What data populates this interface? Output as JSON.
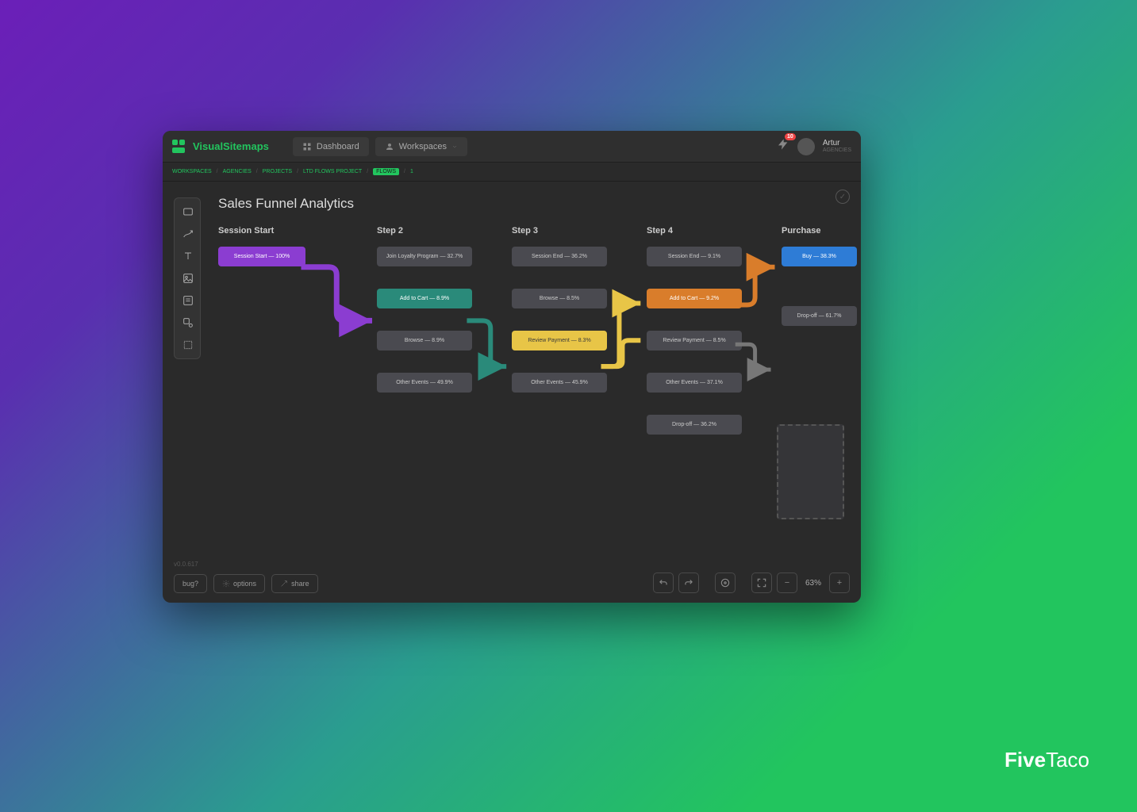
{
  "brand": "VisualSitemaps",
  "nav": {
    "dashboard": "Dashboard",
    "workspaces": "Workspaces"
  },
  "notif_count": "10",
  "user": {
    "name": "Artur",
    "role": "AGENCIES"
  },
  "breadcrumbs": [
    "WORKSPACES",
    "AGENCIES",
    "PROJECTS",
    "LTD FLOWS PROJECT",
    "FLOWS",
    "1"
  ],
  "canvas_title": "Sales Funnel Analytics",
  "columns": {
    "c1": {
      "header": "Session Start",
      "nodes": [
        {
          "label": "Session Start — 100%"
        }
      ]
    },
    "c2": {
      "header": "Step 2",
      "nodes": [
        {
          "label": "Join Loyalty Program — 32.7%"
        },
        {
          "label": "Add to Cart — 8.9%"
        },
        {
          "label": "Browse — 8.9%"
        },
        {
          "label": "Other Events — 49.9%"
        }
      ]
    },
    "c3": {
      "header": "Step 3",
      "nodes": [
        {
          "label": "Session End — 36.2%"
        },
        {
          "label": "Browse — 8.5%"
        },
        {
          "label": "Review Payment — 8.3%"
        },
        {
          "label": "Other Events — 45.9%"
        }
      ]
    },
    "c4": {
      "header": "Step 4",
      "nodes": [
        {
          "label": "Session End — 9.1%"
        },
        {
          "label": "Add to Cart — 9.2%"
        },
        {
          "label": "Review Payment — 8.5%"
        },
        {
          "label": "Other Events — 37.1%"
        },
        {
          "label": "Drop-off — 36.2%"
        }
      ]
    },
    "c5": {
      "header": "Purchase",
      "nodes": [
        {
          "label": "Buy — 38.3%"
        },
        {
          "label": "Drop-off — 61.7%"
        }
      ]
    }
  },
  "footer": {
    "version": "v0.0.617",
    "bug": "bug?",
    "options": "options",
    "share": "share",
    "zoom": "63%"
  },
  "watermark": {
    "a": "Five",
    "b": "Taco"
  }
}
